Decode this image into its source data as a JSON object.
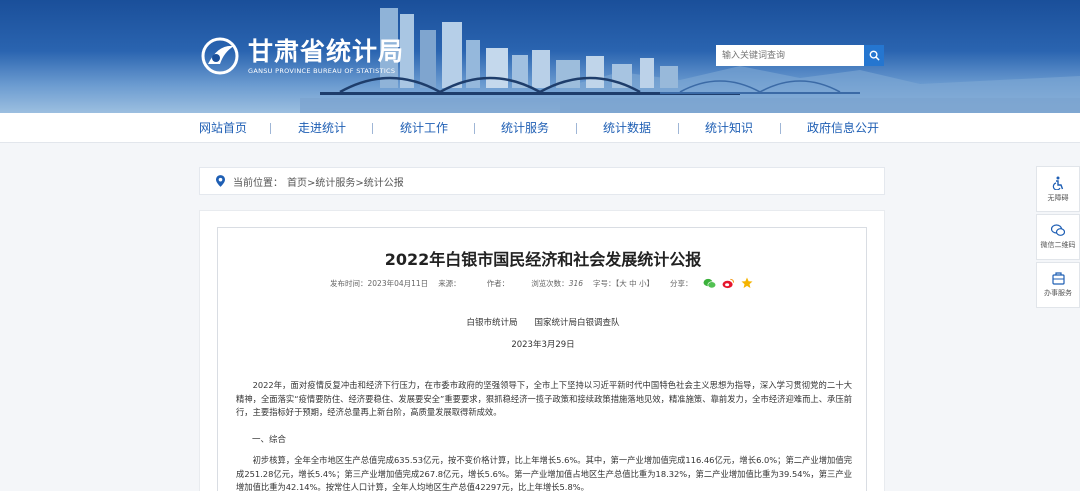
{
  "header": {
    "site_name": "甘肃省统计局",
    "site_name_en": "GANSU PROVINCE BUREAU OF STATISTICS",
    "search_placeholder": "输入关键词查询"
  },
  "nav": {
    "items": [
      "网站首页",
      "走进统计",
      "统计工作",
      "统计服务",
      "统计数据",
      "统计知识",
      "政府信息公开"
    ]
  },
  "breadcrumb": {
    "label": "当前位置：",
    "path": "首页>统计服务>统计公报"
  },
  "article": {
    "title": "2022年白银市国民经济和社会发展统计公报",
    "publish_label": "发布时间：2023年04月11日",
    "source_label": "来源：",
    "author_label": "作者：",
    "views_label": "浏览次数：",
    "views_count": "316",
    "fontsize_label": "字号：【大 中 小】",
    "share_label": "分享：",
    "issuer": "白银市统计局　　国家统计局白银调查队",
    "date": "2023年3月29日",
    "intro": "2022年，面对疫情反复冲击和经济下行压力，在市委市政府的坚强领导下，全市上下坚持以习近平新时代中国特色社会主义思想为指导，深入学习贯彻党的二十大精神，全面落实“疫情要防住、经济要稳住、发展要安全”重要要求，狠抓稳经济一揽子政策和接续政策措施落地见效，精准施策、靠前发力，全市经济迎难而上、承压前行，主要指标好于预期，经济总量再上新台阶，高质量发展取得新成效。",
    "section1": "一、综合",
    "para1": "初步核算，全年全市地区生产总值完成635.53亿元，按不变价格计算，比上年增长5.6%。其中，第一产业增加值完成116.46亿元，增长6.0%；第二产业增加值完成251.28亿元，增长5.4%；第三产业增加值完成267.8亿元，增长5.6%。第一产业增加值占地区生产总值比重为18.32%，第二产业增加值比重为39.54%，第三产业增加值比重为42.14%。按常住人口计算，全年人均地区生产总值42297元，比上年增长5.8%。"
  },
  "side_tools": [
    {
      "label": "无障碍",
      "icon": "accessibility-icon"
    },
    {
      "label": "微信二维码",
      "icon": "wechat-icon"
    },
    {
      "label": "办事服务",
      "icon": "service-icon"
    }
  ],
  "colors": {
    "nav_text": "#1f5fb4",
    "banner_top": "#1a4f9a",
    "search_button": "#2576d0"
  }
}
